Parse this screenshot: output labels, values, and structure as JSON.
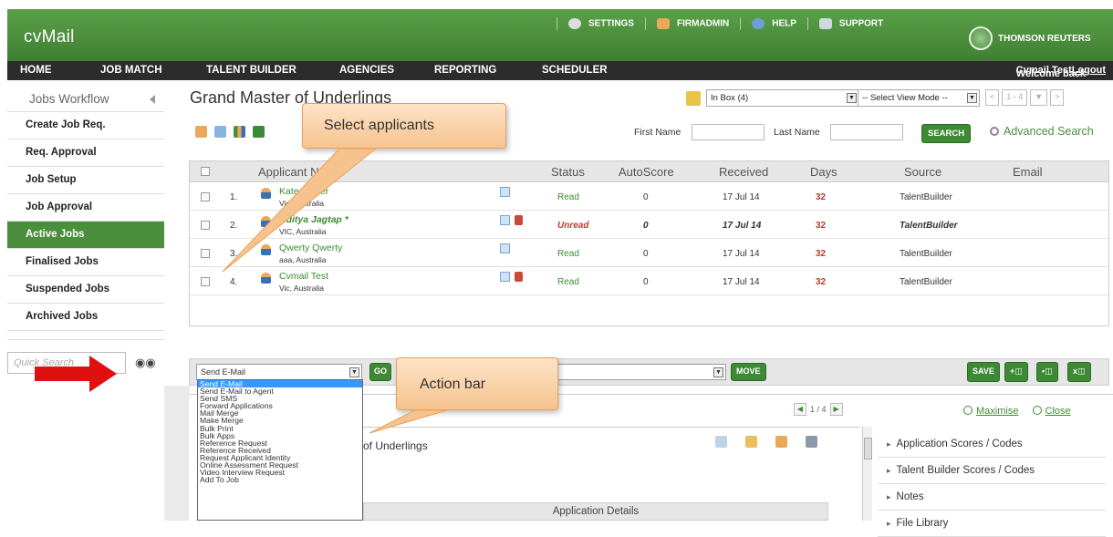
{
  "app": {
    "title": "cvMail"
  },
  "toplinks": [
    {
      "label": "SETTINGS",
      "icon": "gear-icon"
    },
    {
      "label": "FIRMADMIN",
      "icon": "users-icon"
    },
    {
      "label": "HELP",
      "icon": "help-icon"
    },
    {
      "label": "SUPPORT",
      "icon": "support-icon"
    }
  ],
  "brand": "THOMSON REUTERS",
  "nav": {
    "items": [
      "HOME",
      "JOB MATCH",
      "TALENT BUILDER",
      "AGENCIES",
      "REPORTING",
      "SCHEDULER"
    ],
    "welcome": "Welcome back",
    "user": "Cvmail Test",
    "separator": " - ",
    "logout": "Logout"
  },
  "sidebar": {
    "heading": "Jobs Workflow",
    "items": [
      "Create Job Req.",
      "Req. Approval",
      "Job Setup",
      "Job Approval",
      "Active Jobs",
      "Finalised Jobs",
      "Suspended Jobs",
      "Archived Jobs"
    ],
    "active": "Active Jobs",
    "quick_search_placeholder": "Quick Search"
  },
  "main": {
    "title": "Grand Master of Underlings",
    "inbox": "In Box (4)",
    "view_mode": "-- Select View Mode --",
    "pager": "1 - 4",
    "first_name_label": "First Name",
    "last_name_label": "Last Name",
    "search_button": "SEARCH",
    "advanced_search": "Advanced Search"
  },
  "table": {
    "columns": [
      "Applicant Name",
      "Status",
      "AutoScore",
      "Received",
      "Days",
      "Source",
      "Email"
    ],
    "rows": [
      {
        "num": "1.",
        "name": "Kate Maher",
        "location": "Vic, Australia",
        "status": "Read",
        "autoscore": "0",
        "received": "17 Jul 14",
        "days": "32",
        "source": "TalentBuilder",
        "flag": false
      },
      {
        "num": "2.",
        "name": "Aditya Jagtap *",
        "location": "VIC, Australia",
        "status": "Unread",
        "autoscore": "0",
        "received": "17 Jul 14",
        "days": "32",
        "source": "TalentBuilder",
        "flag": true
      },
      {
        "num": "3.",
        "name": "Qwerty Qwerty",
        "location": "aaa, Australia",
        "status": "Read",
        "autoscore": "0",
        "received": "17 Jul 14",
        "days": "32",
        "source": "TalentBuilder",
        "flag": false
      },
      {
        "num": "4.",
        "name": "Cvmail Test",
        "location": "Vic, Australia",
        "status": "Read",
        "autoscore": "0",
        "received": "17 Jul 14",
        "days": "32",
        "source": "TalentBuilder",
        "flag": true
      }
    ]
  },
  "actionbar": {
    "action": "Send E-Mail",
    "go": "GO",
    "move": "MOVE",
    "save": "SAVE",
    "cart_add": "+",
    "cart_view": "•",
    "cart_remove": "x",
    "options": [
      "Send E-Mail",
      "Send E-Mail to Agent",
      "Send SMS",
      "Forward Applications",
      "Mail Merge",
      "Make Merge",
      "Bulk Print",
      "Bulk Apps",
      "Reference Request",
      "Reference Received",
      "Request Applicant Identity",
      "Online Assessment Request",
      "Video Interview Request",
      "Add To Job"
    ]
  },
  "preview": {
    "pager": "1 / 4",
    "maximise": "Maximise",
    "close": "Close",
    "title": "Grand Master of Underlings",
    "visible_title": "of Underlings",
    "app_details": "Application Details",
    "panels": [
      "Application Scores / Codes",
      "Talent Builder Scores / Codes",
      "Notes",
      "File Library"
    ]
  },
  "callouts": {
    "select": "Select applicants",
    "action": "Action bar"
  },
  "colors": {
    "brand_green": "#4a8f3c",
    "nav_dark": "#2c2c2c",
    "unread_red": "#c0392b",
    "callout": "#f6c38f",
    "arrow": "#e01010"
  }
}
